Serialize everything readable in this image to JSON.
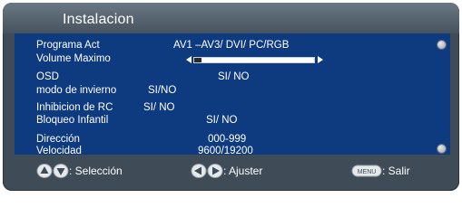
{
  "window": {
    "title": "Instalacion"
  },
  "menu": {
    "programa_act": {
      "label": "Programa Act",
      "value": "AV1 –AV3/ DVI/ PC/RGB"
    },
    "volumen_maximo": {
      "label": "Volume Maximo",
      "level": 0.06
    },
    "osd": {
      "label": "OSD",
      "value": "SI/ NO"
    },
    "modo_invierno": {
      "label": "modo de invierno",
      "value": "SI/NO"
    },
    "inhibicion_rc": {
      "label": "Inhibicion de RC",
      "value": "SI/ NO"
    },
    "bloqueo_infantil": {
      "label": "Bloqueo Infantil",
      "value": "SI/ NO"
    },
    "direccion": {
      "label": "Dirección",
      "value": "000-999"
    },
    "velocidad": {
      "label": "Velocidad",
      "value": "9600/19200"
    }
  },
  "footer": {
    "select_label": ": Selección",
    "adjust_label": ": Ajuster",
    "exit_label": ": Salir",
    "menu_key_label": "MENU"
  },
  "colors": {
    "frame": "#3f4c57",
    "panel": "#0e3a80",
    "text": "#ffffff"
  },
  "icons": {
    "select": "up-down-arrows-icon",
    "adjust": "left-right-arrows-icon",
    "exit": "menu-key-icon",
    "scroll_top": "scroll-indicator-icon",
    "scroll_bottom": "scroll-indicator-icon"
  }
}
